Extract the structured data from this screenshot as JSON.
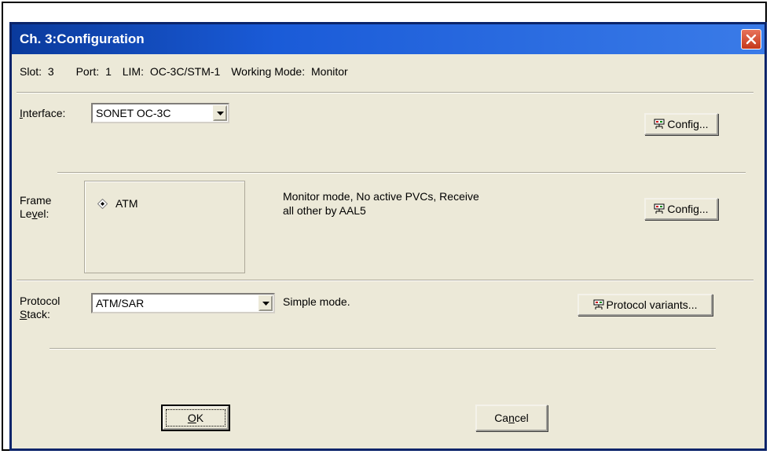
{
  "window": {
    "title": "Ch. 3:Configuration"
  },
  "info": {
    "slot_label": "Slot:",
    "slot_value": "3",
    "port_label": "Port:",
    "port_value": "1",
    "lim_label": "LIM:",
    "lim_value": "OC-3C/STM-1",
    "mode_label": "Working Mode:",
    "mode_value": "Monitor"
  },
  "interface": {
    "label_pre": "",
    "label_u": "I",
    "label_post": "nterface:",
    "selected": "SONET OC-3C",
    "config_button": "Config..."
  },
  "frame_level": {
    "label_line1": "Frame",
    "label_line2_pre": "Le",
    "label_line2_u": "v",
    "label_line2_post": "el:",
    "option": "ATM",
    "description_line1": "Monitor mode, No active PVCs, Receive",
    "description_line2": "all other by AAL5",
    "config_button": "Config..."
  },
  "protocol_stack": {
    "label_line1": "Protocol",
    "label_line2_u": "S",
    "label_line2_post": "tack:",
    "selected": "ATM/SAR",
    "description": "Simple mode.",
    "variants_button": "Protocol variants..."
  },
  "footer": {
    "ok_u": "O",
    "ok_post": "K",
    "cancel_pre": "Ca",
    "cancel_u": "n",
    "cancel_post": "cel"
  },
  "icons": {
    "config_icon": "network-config-icon",
    "close_icon": "close-icon",
    "dropdown_icon": "chevron-down-icon"
  },
  "colors": {
    "titlebar": "#1a5bd8",
    "dialog_bg": "#ece9d8",
    "close_button": "#d4502e"
  }
}
